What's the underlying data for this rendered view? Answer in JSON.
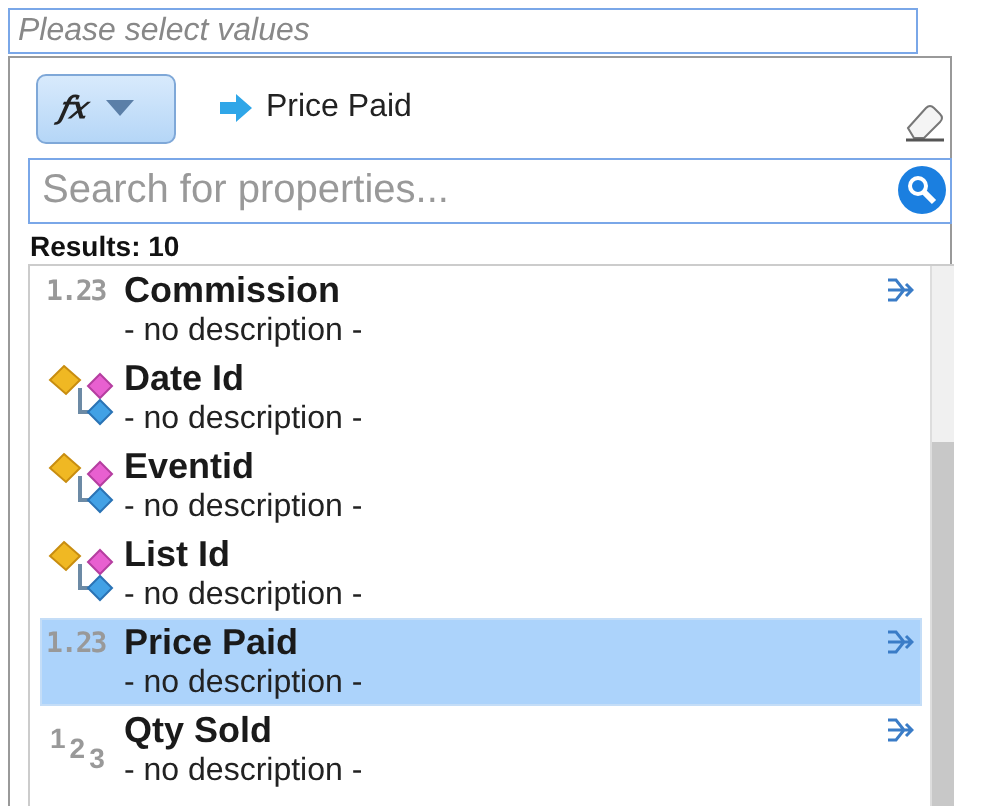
{
  "value_field": {
    "placeholder": "Please select values"
  },
  "toolbar": {
    "function_button": "𝑓𝑥",
    "current_property": "Price Paid"
  },
  "search": {
    "placeholder": "Search for properties..."
  },
  "results": "Results: 10",
  "properties": [
    {
      "kind": "decimal",
      "type_label": "1.23",
      "name": "Commission",
      "description": "- no description -",
      "selected": false,
      "mapped": true
    },
    {
      "kind": "key",
      "name": "Date Id",
      "description": "- no description -",
      "selected": false,
      "mapped": false
    },
    {
      "kind": "key",
      "name": "Eventid",
      "description": "- no description -",
      "selected": false,
      "mapped": false
    },
    {
      "kind": "key",
      "name": "List Id",
      "description": "- no description -",
      "selected": false,
      "mapped": false
    },
    {
      "kind": "decimal",
      "type_label": "1.23",
      "name": "Price Paid",
      "description": "- no description -",
      "selected": true,
      "mapped": true
    },
    {
      "kind": "integer",
      "type_label": "123",
      "name": "Qty Sold",
      "description": "- no description -",
      "selected": false,
      "mapped": true
    }
  ]
}
